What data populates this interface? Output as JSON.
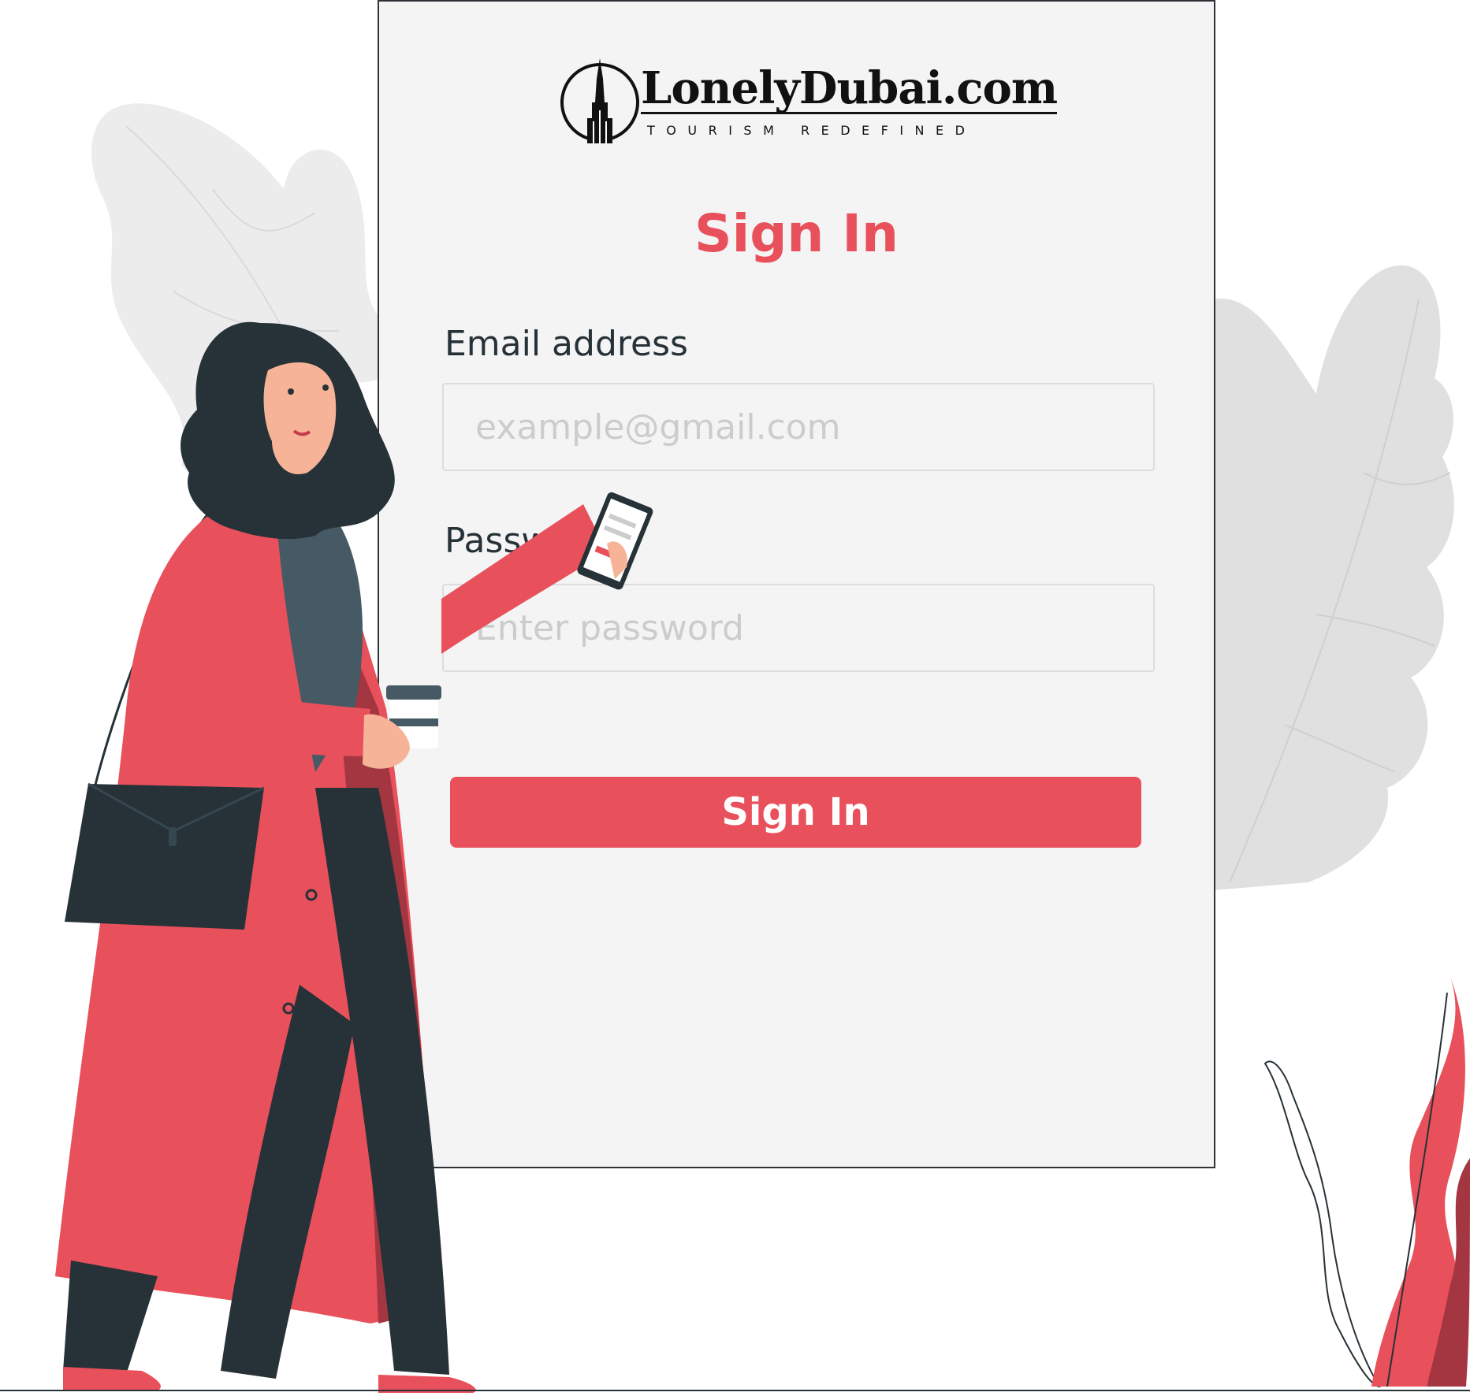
{
  "brand": {
    "name": "LonelyDubai.com",
    "tagline": "TOURISM REDEFINED"
  },
  "form": {
    "title": "Sign In",
    "email": {
      "label": "Email address",
      "placeholder": "example@gmail.com",
      "value": ""
    },
    "password": {
      "label": "Password",
      "placeholder": "Enter password",
      "value": ""
    },
    "submit_label": "Sign In"
  },
  "colors": {
    "accent": "#e8505b",
    "card_background": "#f4f4f4",
    "text_dark": "#263238",
    "placeholder": "#cccccc",
    "leaf_grey": "#e6e6e6"
  },
  "icons": {
    "brand_mark": "burj-khalifa-icon"
  }
}
